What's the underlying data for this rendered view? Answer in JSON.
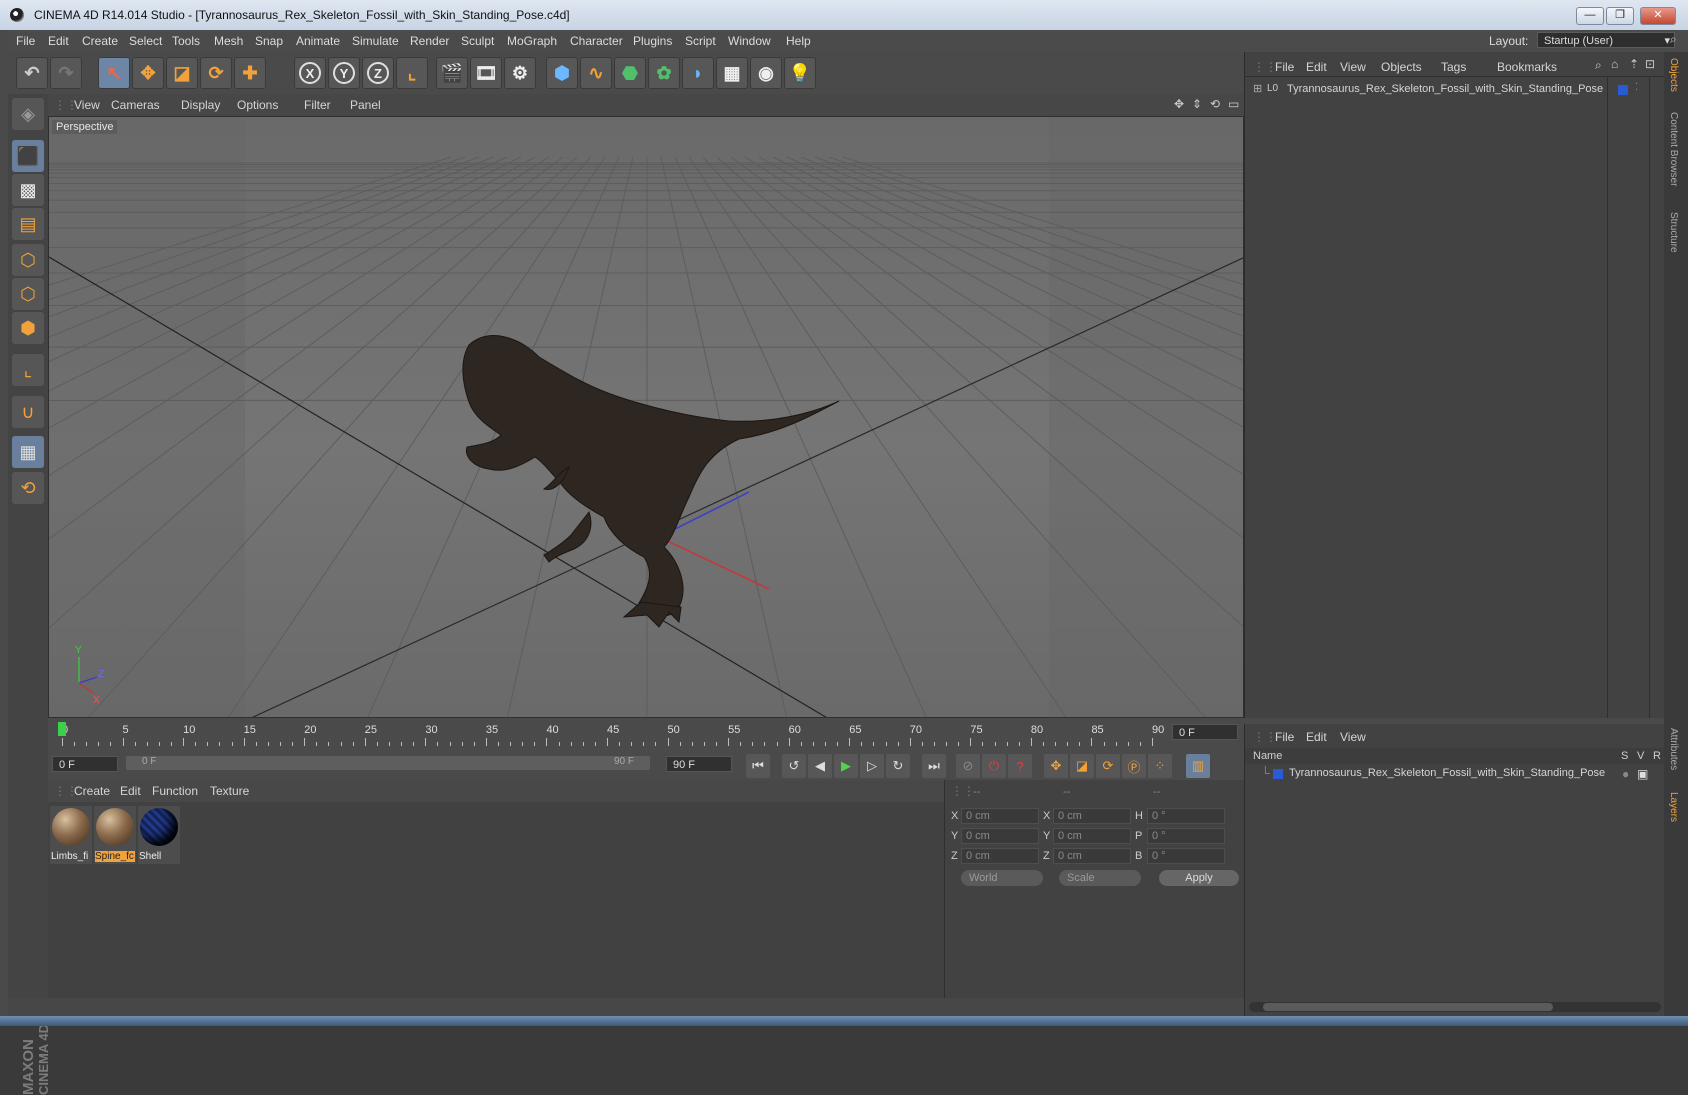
{
  "window": {
    "title": "CINEMA 4D R14.014 Studio - [Tyrannosaurus_Rex_Skeleton_Fossil_with_Skin_Standing_Pose.c4d]",
    "minimize": "—",
    "restore": "❐",
    "close": "✕"
  },
  "menubar": {
    "items": [
      "File",
      "Edit",
      "Create",
      "Select",
      "Tools",
      "Mesh",
      "Snap",
      "Animate",
      "Simulate",
      "Render",
      "Sculpt",
      "MoGraph",
      "Character",
      "Plugins",
      "Script",
      "Window",
      "Help"
    ],
    "layout_label": "Layout:",
    "layout_value": "Startup (User)"
  },
  "toolbar": {
    "axis_x": "X",
    "axis_y": "Y",
    "axis_z": "Z"
  },
  "viewport": {
    "menu": [
      "View",
      "Cameras",
      "Display",
      "Options",
      "Filter",
      "Panel"
    ],
    "label": "Perspective",
    "axis_y": "Y",
    "axis_z": "Z",
    "axis_x": "X"
  },
  "timeline": {
    "ticks": [
      "0",
      "5",
      "10",
      "15",
      "20",
      "25",
      "30",
      "35",
      "40",
      "45",
      "50",
      "55",
      "60",
      "65",
      "70",
      "75",
      "80",
      "85",
      "90"
    ],
    "current_frame": "0 F",
    "start_frame": "0 F",
    "range_start": "0 F",
    "range_end": "90 F",
    "end_frame": "90 F"
  },
  "materials": {
    "menu": [
      "Create",
      "Edit",
      "Function",
      "Texture"
    ],
    "items": [
      {
        "name": "Limbs_fi",
        "color": "#8a6a4a"
      },
      {
        "name": "Spine_fc",
        "color": "#8a6a4a"
      },
      {
        "name": "Shell",
        "color": "#1a2a6a"
      }
    ]
  },
  "coordinates": {
    "headers": [
      "--",
      "--",
      "--"
    ],
    "rows": [
      {
        "axis": "X",
        "pos": "0 cm",
        "axis2": "X",
        "size": "0 cm",
        "axis3": "H",
        "rot": "0 °"
      },
      {
        "axis": "Y",
        "pos": "0 cm",
        "axis2": "Y",
        "size": "0 cm",
        "axis3": "P",
        "rot": "0 °"
      },
      {
        "axis": "Z",
        "pos": "0 cm",
        "axis2": "Z",
        "size": "0 cm",
        "axis3": "B",
        "rot": "0 °"
      }
    ],
    "mode": "World",
    "transform": "Scale",
    "apply": "Apply"
  },
  "objects_panel": {
    "menu": [
      "File",
      "Edit",
      "View",
      "Objects",
      "Tags",
      "Bookmarks"
    ],
    "object_name": "Tyrannosaurus_Rex_Skeleton_Fossil_with_Skin_Standing_Pose",
    "object_prefix": "L0"
  },
  "layers_panel": {
    "menu": [
      "File",
      "Edit",
      "View"
    ],
    "col_name": "Name",
    "col_s": "S",
    "col_v": "V",
    "col_r": "R",
    "layer_name": "Tyrannosaurus_Rex_Skeleton_Fossil_with_Skin_Standing_Pose"
  },
  "sidetabs": {
    "top": [
      "Objects",
      "Content Browser",
      "Structure"
    ],
    "bottom": [
      "Attributes",
      "Layers"
    ]
  },
  "brand": {
    "maxon": "MAXON",
    "cinema": "CINEMA 4D"
  },
  "colors": {
    "accent": "#f2a23a",
    "selection": "#6a7f9c",
    "play": "#55d14a",
    "layer_blue": "#2a5bd7"
  }
}
